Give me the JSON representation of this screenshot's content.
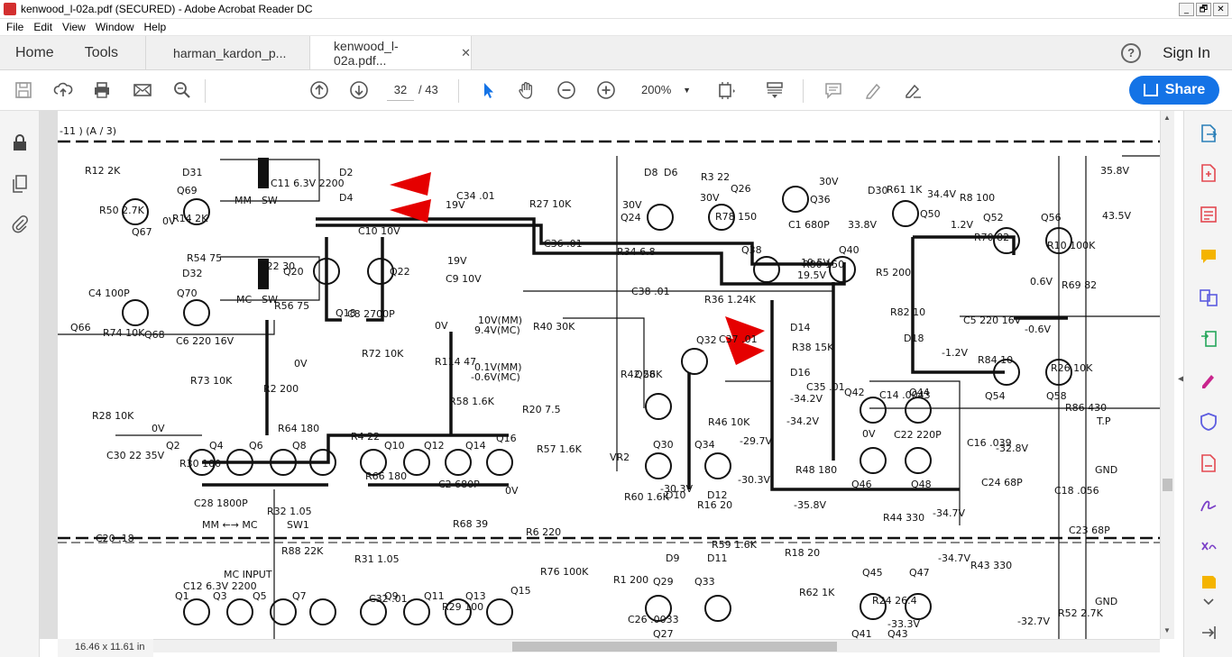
{
  "window": {
    "title": "kenwood_l-02a.pdf (SECURED) - Adobe Acrobat Reader DC",
    "buttons": [
      "_",
      "🗗",
      "✕"
    ]
  },
  "menu": [
    "File",
    "Edit",
    "View",
    "Window",
    "Help"
  ],
  "tabs": {
    "home": "Home",
    "tools": "Tools",
    "doc1": "harman_kardon_p...",
    "doc2": "kenwood_l-02a.pdf...",
    "close": "✕",
    "help": "?",
    "sign_in": "Sign In"
  },
  "toolbar": {
    "current_page": "32",
    "total_pages": "/ 43",
    "zoom": "200%",
    "share": "Share"
  },
  "document": {
    "size_label": "16.46 x 11.61 in",
    "schematic_labels": {
      "header": "-11 ) (A / 3)",
      "mm_sw": "MM - SW",
      "mc_sw": "MC - SW",
      "mc_input": "MC INPUT",
      "mm_mc": "MM ←→ MC",
      "sw1": "SW1",
      "tp": "T.P",
      "gnd1": "GND",
      "gnd2": "GND",
      "v19a": "19V",
      "v19b": "19V",
      "v10": "10V(MM)",
      "v94": "9.4V(MC)",
      "v01": "0.1V(MM)",
      "v06": "-0.6V(MC)",
      "v30a": "30V",
      "v30b": "30V",
      "v30c": "30V",
      "v338": "33.8V",
      "v344": "34.4V",
      "v12": "1.2V",
      "v358": "35.8V",
      "v435": "43.5V",
      "v06b": "0.6V",
      "v06c": "-0.6V",
      "v12b": "-1.2V",
      "v342": "-34.2V",
      "v342b": "-34.2V",
      "v297": "-29.7V",
      "v303": "-30.3V",
      "v303b": "-30.3V",
      "v358b": "-35.8V",
      "v347": "-34.7V",
      "v328": "-32.8V",
      "v327": "-32.7V",
      "v347b": "-34.7V",
      "v333": "-33.3V",
      "v195a": "19.5V",
      "v195b": "19.5V",
      "v0a": "0V",
      "v0b": "0V",
      "v0c": "0V",
      "v0d": "0V",
      "v0e": "0V",
      "v0f": "0V",
      "q_labels": [
        "Q69",
        "Q67",
        "Q70",
        "Q66",
        "Q68",
        "Q20",
        "Q22",
        "Q18",
        "Q2",
        "Q4",
        "Q6",
        "Q8",
        "Q10",
        "Q12",
        "Q14",
        "Q16",
        "Q1",
        "Q3",
        "Q5",
        "Q7",
        "Q9",
        "Q11",
        "Q13",
        "Q15",
        "Q24",
        "Q26",
        "Q36",
        "Q38",
        "Q40",
        "Q50",
        "Q52",
        "Q56",
        "Q28",
        "Q32",
        "Q30",
        "Q34",
        "Q29",
        "Q33",
        "Q27",
        "Q42",
        "Q44",
        "Q46",
        "Q48",
        "Q45",
        "Q47",
        "Q41",
        "Q43",
        "Q54",
        "Q58"
      ],
      "d_labels": [
        "D31",
        "D32",
        "D2",
        "D4",
        "D14",
        "D16",
        "D8",
        "D6",
        "D30",
        "D18",
        "D10",
        "D12",
        "D9",
        "D11"
      ],
      "r_labels": [
        "R12 2K",
        "R14 2K",
        "R22 30",
        "C8 2700P",
        "R114 47",
        "R20 7.5",
        "VR2",
        "R16 20",
        "R18 20",
        "R24 26.4",
        "R8 100",
        "R10 100K",
        "C4 100P",
        "C6 220 16V",
        "R2 200",
        "R4 22",
        "C2 680P",
        "R6 220",
        "R1 200",
        "R3 22",
        "C1 680P",
        "R5 200",
        "C5 220 16V",
        "R26 10K",
        "R28 10K",
        "R30 100",
        "R32 1.05",
        "R31 1.05",
        "R29 100",
        "R27 10K",
        "R34 6.8",
        "R36 1.24K",
        "R38 15K",
        "C14 .0043",
        "C16 .039",
        "C18 .056",
        "C20 .18",
        "C12 6.3V 2200",
        "C11 6.3V 2200",
        "C10 10V",
        "C9 10V",
        "R40 30K",
        "R42 56K",
        "R46 10K",
        "R48 180",
        "R44 330",
        "R43 330",
        "R52 2.7K",
        "R50 2.7K",
        "R54 75",
        "R56 75",
        "R72 10K",
        "R58 1.6K",
        "R57 1.6K",
        "R60 1.6K",
        "R59 1.6K",
        "R62 1K",
        "R61 1K",
        "R70 82",
        "R69 82",
        "R74 10K",
        "R73 10K",
        "R64 180",
        "R66 180",
        "R68 39",
        "R76 100K",
        "C26 .0033",
        "R78 150",
        "R80 150",
        "R82 10",
        "R84 10",
        "R86 430",
        "C30 22 35V",
        "C28 1800P",
        "R88 22K",
        "C32 .01",
        "C34 .01",
        "C36 .01",
        "C38 .01",
        "C37 .01",
        "C35 .01",
        "C22 220P",
        "C24 68P",
        "C23 68P"
      ]
    }
  }
}
